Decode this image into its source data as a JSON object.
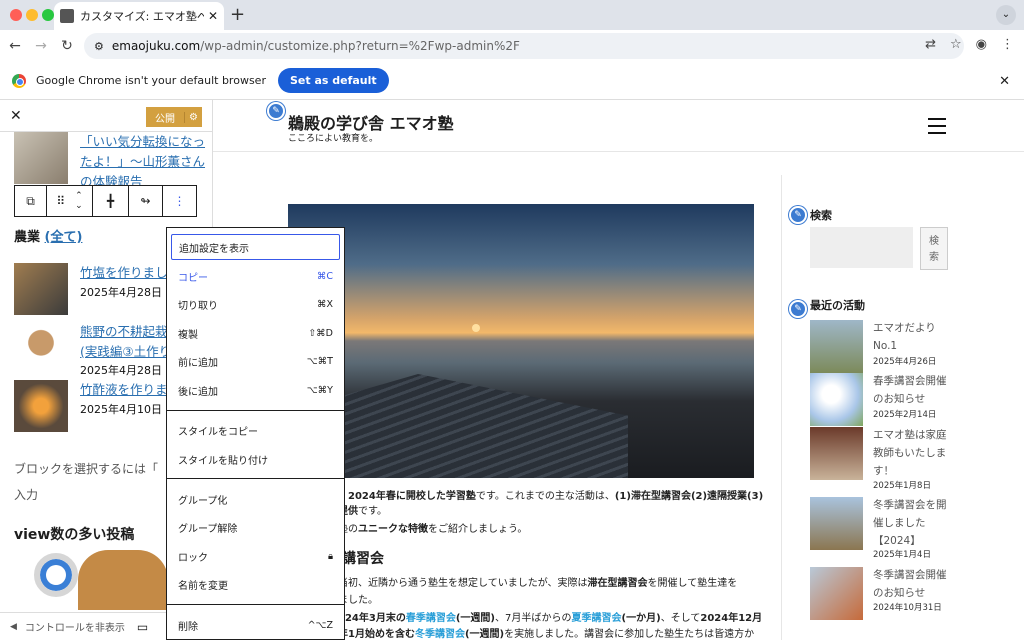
{
  "browser": {
    "tab_title": "カスタマイズ: エマオ塾へようこ",
    "url_domain": "emaojuku.com",
    "url_path": "/wp-admin/customize.php?return=%2Fwp-admin%2F",
    "infobar_text": "Google Chrome isn't your default browser",
    "set_default_label": "Set as default"
  },
  "panel": {
    "publish_label": "公開",
    "post_title": "「いい気分転換になったよ！」〜山形薫さんの体験報告",
    "category_label": "農業",
    "category_all_label": "(全て)",
    "posts": [
      {
        "title": "竹塩を作りまし",
        "date": "2025年4月28日"
      },
      {
        "title": "熊野の不耕起栽",
        "subtitle": "(実践編③土作り",
        "date": "2025年4月28日"
      },
      {
        "title": "竹酢液を作りま",
        "date": "2025年4月10日"
      }
    ],
    "select_block_hint": "ブロックを選択するには「",
    "select_block_hint2": "入力",
    "popular_heading": "view数の多い投稿",
    "footer_label": "コントロールを非表示"
  },
  "context_menu": {
    "items": [
      {
        "label": "追加設定を表示",
        "shortcut": ""
      },
      {
        "label": "コピー",
        "shortcut": "⌘C"
      },
      {
        "label": "切り取り",
        "shortcut": "⌘X"
      },
      {
        "label": "複製",
        "shortcut": "⇧⌘D"
      },
      {
        "label": "前に追加",
        "shortcut": "⌥⌘T"
      },
      {
        "label": "後に追加",
        "shortcut": "⌥⌘Y"
      },
      {
        "label": "スタイルをコピー",
        "shortcut": ""
      },
      {
        "label": "スタイルを貼り付け",
        "shortcut": ""
      },
      {
        "label": "グループ化",
        "shortcut": ""
      },
      {
        "label": "グループ解除",
        "shortcut": ""
      },
      {
        "label": "ロック",
        "shortcut": "lock-icon"
      },
      {
        "label": "名前を変更",
        "shortcut": ""
      },
      {
        "label": "削除",
        "shortcut": "^⌥Z"
      }
    ]
  },
  "site": {
    "title": "鵜殿の学び舎 エマオ塾",
    "tagline": "こころによい教育を。",
    "body_line1_a": "、",
    "body_line1_b": "2024年春に開校した学習塾",
    "body_line1_c": "です。これまでの主な活動は、",
    "body_line1_d": "(1)滞在型講習会(2)遠隔授業(3)",
    "body_line2_a": "提供",
    "body_line2_b": "です。",
    "body_line3_a": "塾の",
    "body_line3_b": "ユニークな特徴",
    "body_line3_c": "をご紹介しましょう。",
    "heading": "講習会",
    "body_line4_a": "当初、近隣から通う塾生を想定していましたが、実際は",
    "body_line4_b": "滞在型講習会",
    "body_line4_c": "を開催して塾生達を",
    "body_line5": "ました。",
    "body_line6_a": "024年3月末の",
    "body_line6_b": "春季講習会",
    "body_line6_c": "(一週間)",
    "body_line6_d": "、7月半ばからの",
    "body_line6_e": "夏季講習会",
    "body_line6_f": "(一か月)",
    "body_line6_g": "、そして",
    "body_line6_h": "2024年12月",
    "body_line7_a": "年1月始めを含む",
    "body_line7_b": "冬季講習会",
    "body_line7_c": "(一週間)",
    "body_line7_d": "を実施しました。講習会に参加した塾生たちは皆遠方か",
    "search_heading": "検索",
    "search_button": "検索",
    "recent_heading": "最近の活動",
    "recent": [
      {
        "title1": "エマオだより",
        "title2": "No.1",
        "date": "2025年4月26日"
      },
      {
        "title1": "春季講習会開催",
        "title2": "のお知らせ",
        "date": "2025年2月14日"
      },
      {
        "title1": "エマオ塾は家庭",
        "title2": "教師もいたしま",
        "title3": "す！",
        "date": "2025年1月8日"
      },
      {
        "title1": "冬季講習会を開",
        "title2": "催しました",
        "title3": "【2024】",
        "date": "2025年1月4日"
      },
      {
        "title1": "冬季講習会開催",
        "title2": "のお知らせ",
        "date": "2024年10月31日"
      }
    ]
  }
}
